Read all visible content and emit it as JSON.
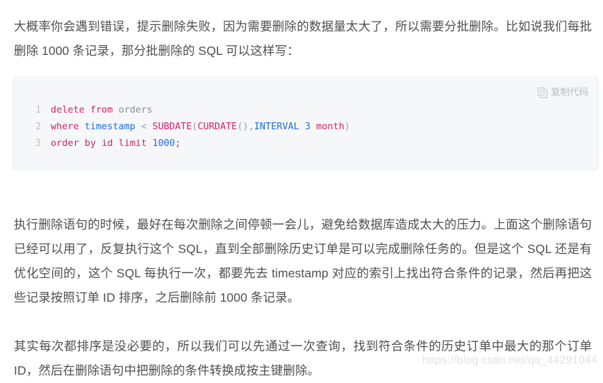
{
  "paragraphs": {
    "intro": "大概率你会遇到错误，提示删除失败，因为需要删除的数据量太大了，所以需要分批删除。比如说我们每批删除 1000 条记录，那分批删除的 SQL 可以这样写：",
    "exec": "执行删除语句的时候，最好在每次删除之间停顿一会儿，避免给数据库造成太大的压力。上面这个删除语句已经可以用了，反复执行这个 SQL，直到全部删除历史订单是可以完成删除任务的。但是这个 SQL 还是有优化空间的，这个 SQL 每执行一次，都要先去 timestamp 对应的索引上找出符合条件的记录，然后再把这些记录按照订单 ID 排序，之后删除前 1000 条记录。",
    "final": "其实每次都排序是没必要的，所以我们可以先通过一次查询，找到符合条件的历史订单中最大的那个订单 ID，然后在删除语句中把删除的条件转换成按主键删除。"
  },
  "code_block": {
    "language": "sql",
    "copy_button": {
      "label": "复制代码",
      "icon": "copy-icon"
    },
    "line_numbers": [
      "1",
      "2",
      "3"
    ],
    "lines": [
      {
        "number": "1",
        "plain": "delete from orders",
        "tokens": [
          {
            "text": "delete",
            "type": "kw"
          },
          {
            "text": " ",
            "type": "plain"
          },
          {
            "text": "from",
            "type": "kw"
          },
          {
            "text": " ",
            "type": "plain"
          },
          {
            "text": "orders",
            "type": "id"
          }
        ]
      },
      {
        "number": "2",
        "plain": "where timestamp < SUBDATE(CURDATE(),INTERVAL 3 month)",
        "tokens": [
          {
            "text": "where",
            "type": "kw"
          },
          {
            "text": " ",
            "type": "plain"
          },
          {
            "text": "timestamp",
            "type": "type"
          },
          {
            "text": " ",
            "type": "plain"
          },
          {
            "text": "<",
            "type": "op"
          },
          {
            "text": " ",
            "type": "plain"
          },
          {
            "text": "SUBDATE",
            "type": "fn"
          },
          {
            "text": "(",
            "type": "punc"
          },
          {
            "text": "CURDATE",
            "type": "fn"
          },
          {
            "text": "()",
            "type": "punc"
          },
          {
            "text": ",",
            "type": "punc"
          },
          {
            "text": "INTERVAL",
            "type": "type"
          },
          {
            "text": " ",
            "type": "plain"
          },
          {
            "text": "3",
            "type": "num"
          },
          {
            "text": " ",
            "type": "plain"
          },
          {
            "text": "month",
            "type": "kw"
          },
          {
            "text": ")",
            "type": "punc"
          }
        ]
      },
      {
        "number": "3",
        "plain": "order by id limit 1000;",
        "tokens": [
          {
            "text": "order",
            "type": "kw"
          },
          {
            "text": " ",
            "type": "plain"
          },
          {
            "text": "by",
            "type": "kw"
          },
          {
            "text": " ",
            "type": "plain"
          },
          {
            "text": "id",
            "type": "kw"
          },
          {
            "text": " ",
            "type": "plain"
          },
          {
            "text": "limit",
            "type": "kw"
          },
          {
            "text": " ",
            "type": "plain"
          },
          {
            "text": "1000",
            "type": "num"
          },
          {
            "text": ";",
            "type": "kw"
          }
        ]
      }
    ]
  },
  "watermark": {
    "text": "https://blog.csdn.net/qq_44291044"
  },
  "colors": {
    "text": "#4f4f4f",
    "code_background": "#f6f7f9",
    "code_border": "#eceef1",
    "keyword": "#d81f6a",
    "number": "#1d6fe0",
    "type": "#1d6fe0",
    "identifier": "#8b8f96",
    "line_number": "#bcbfc5",
    "copy_label": "#b7bcc4",
    "watermark": "#e2e2e2"
  }
}
